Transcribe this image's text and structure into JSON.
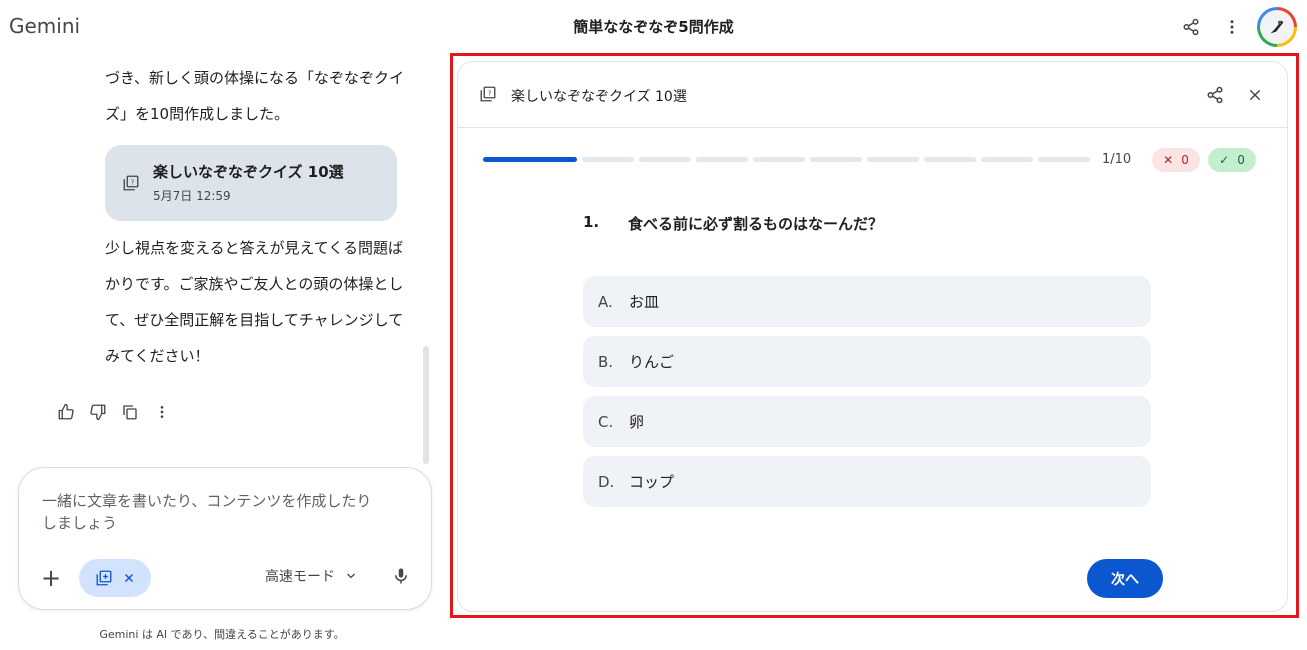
{
  "app": {
    "brand": "Gemini",
    "conversation_title": "簡単ななぞなぞ5問作成"
  },
  "top_icons": {
    "share": "share-icon",
    "menu": "more-vert-icon",
    "avatar": "avatar"
  },
  "chat": {
    "message_top": "づき、新しく頭の体操になる「なぞなぞクイズ」を10問作成しました。",
    "chip": {
      "title": "楽しいなぞなぞクイズ 10選",
      "date": "5月7日 12:59"
    },
    "message_bottom": "少し視点を変えると答えが見えてくる問題ばかりです。ご家族やご友人との頭の体操として、ぜひ全問正解を目指してチャレンジしてみてください！"
  },
  "composer": {
    "placeholder": "一緒に文章を書いたり、コンテンツを作成したりしましょう",
    "mode_label": "高速モード"
  },
  "disclaimer": "Gemini は AI であり、間違えることがあります。",
  "quiz": {
    "title": "楽しいなぞなぞクイズ 10選",
    "progress": {
      "current": 1,
      "total": 10,
      "label": "1/10"
    },
    "wrong_count": "0",
    "right_count": "0",
    "question_number": "1.",
    "question": "食べる前に必ず割るものはなーんだ？",
    "options": [
      {
        "letter": "A.",
        "text": "お皿"
      },
      {
        "letter": "B.",
        "text": "りんご"
      },
      {
        "letter": "C.",
        "text": "卵"
      },
      {
        "letter": "D.",
        "text": "コップ"
      }
    ],
    "next_label": "次へ"
  },
  "colors": {
    "accent": "#0b57d0",
    "highlight_frame": "#e3161d",
    "chip_bg": "#dde3ea",
    "option_bg": "#eff2f7"
  }
}
